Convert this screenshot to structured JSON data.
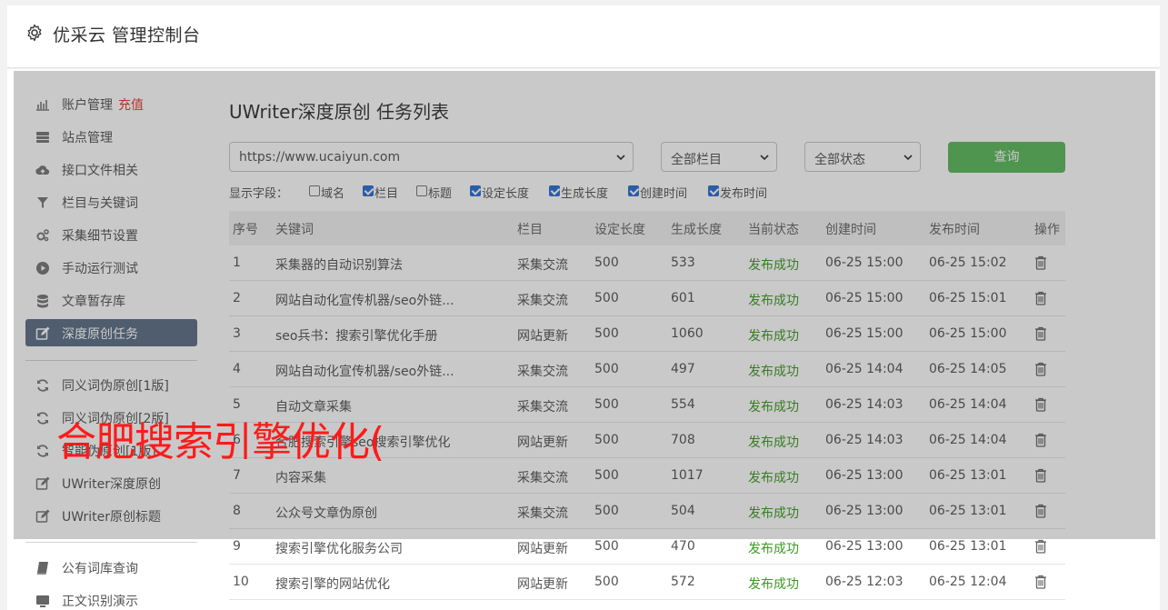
{
  "header": {
    "title": "优采云 管理控制台",
    "icon": "gear-icon"
  },
  "sidebar": {
    "items": [
      {
        "label": "账户管理",
        "extra": "充值",
        "icon": "bar-chart-icon"
      },
      {
        "label": "站点管理",
        "icon": "server-icon"
      },
      {
        "label": "接口文件相关",
        "icon": "cloud-upload-icon"
      },
      {
        "label": "栏目与关键词",
        "icon": "filter-icon"
      },
      {
        "label": "采集细节设置",
        "icon": "cogs-icon"
      },
      {
        "label": "手动运行测试",
        "icon": "play-circle-icon"
      },
      {
        "label": "文章暂存库",
        "icon": "database-icon"
      },
      {
        "label": "深度原创任务",
        "icon": "edit-icon",
        "active": true
      },
      {
        "label": "同义词伪原创[1版]",
        "icon": "refresh-icon"
      },
      {
        "label": "同义词伪原创[2版]",
        "icon": "refresh-icon"
      },
      {
        "label": "智能伪原创[1版]",
        "icon": "refresh-icon"
      },
      {
        "label": "UWriter深度原创",
        "icon": "edit-icon"
      },
      {
        "label": "UWriter原创标题",
        "icon": "edit-icon"
      },
      {
        "label": "公有词库查询",
        "icon": "book-icon"
      },
      {
        "label": "正文识别演示",
        "icon": "monitor-icon"
      }
    ]
  },
  "main": {
    "title": "UWriter深度原创 任务列表",
    "filters": {
      "site": "https://www.ucaiyun.com",
      "column": "全部栏目",
      "status": "全部状态",
      "query_label": "查询"
    },
    "fields_label": "显示字段：",
    "fields": [
      {
        "label": "域名",
        "checked": false
      },
      {
        "label": "栏目",
        "checked": true
      },
      {
        "label": "标题",
        "checked": false
      },
      {
        "label": "设定长度",
        "checked": true
      },
      {
        "label": "生成长度",
        "checked": true
      },
      {
        "label": "创建时间",
        "checked": true
      },
      {
        "label": "发布时间",
        "checked": true
      }
    ],
    "table": {
      "headers": [
        "序号",
        "关键词",
        "栏目",
        "设定长度",
        "生成长度",
        "当前状态",
        "创建时间",
        "发布时间",
        "操作"
      ],
      "rows": [
        [
          "1",
          "采集器的自动识别算法",
          "采集交流",
          "500",
          "533",
          "发布成功",
          "06-25 15:00",
          "06-25 15:02"
        ],
        [
          "2",
          "网站自动化宣传机器/seo外链...",
          "采集交流",
          "500",
          "601",
          "发布成功",
          "06-25 15:00",
          "06-25 15:01"
        ],
        [
          "3",
          "seo兵书：搜索引擎优化手册",
          "网站更新",
          "500",
          "1060",
          "发布成功",
          "06-25 15:00",
          "06-25 15:00"
        ],
        [
          "4",
          "网站自动化宣传机器/seo外链...",
          "采集交流",
          "500",
          "497",
          "发布成功",
          "06-25 14:04",
          "06-25 14:05"
        ],
        [
          "5",
          "自动文章采集",
          "采集交流",
          "500",
          "554",
          "发布成功",
          "06-25 14:03",
          "06-25 14:04"
        ],
        [
          "6",
          "合肥搜索引擎seo搜索引擎优化",
          "网站更新",
          "500",
          "708",
          "发布成功",
          "06-25 14:03",
          "06-25 14:04"
        ],
        [
          "7",
          "内容采集",
          "采集交流",
          "500",
          "1017",
          "发布成功",
          "06-25 13:00",
          "06-25 13:01"
        ],
        [
          "8",
          "公众号文章伪原创",
          "采集交流",
          "500",
          "504",
          "发布成功",
          "06-25 13:00",
          "06-25 13:01"
        ],
        [
          "9",
          "搜索引擎优化服务公司",
          "网站更新",
          "500",
          "470",
          "发布成功",
          "06-25 13:00",
          "06-25 13:01"
        ],
        [
          "10",
          "搜索引擎的网站优化",
          "网站更新",
          "500",
          "572",
          "发布成功",
          "06-25 12:03",
          "06-25 12:04"
        ]
      ]
    }
  },
  "watermark": "合肥搜索引擎优化(",
  "colors": {
    "active_nav": "#5c6f87",
    "query_button": "#5cb85c",
    "status_ok": "#3c9a23",
    "recharge": "#e53935",
    "watermark": "#ff1a1a"
  }
}
